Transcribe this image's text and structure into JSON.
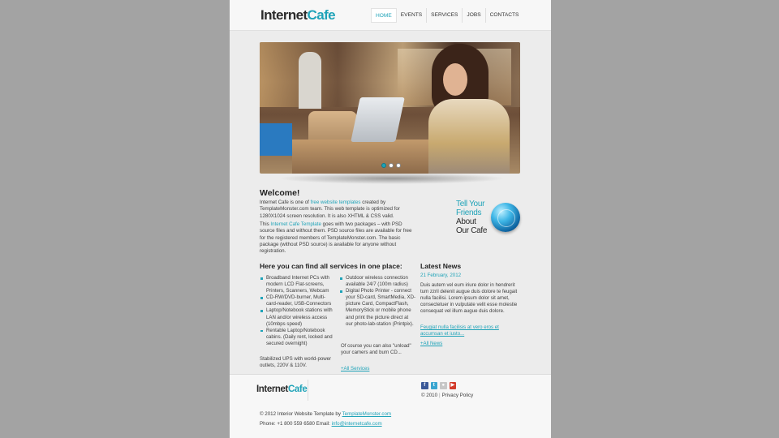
{
  "header": {
    "logo_part1": "Internet",
    "logo_part2": "Cafe",
    "nav": [
      {
        "label": "HOME",
        "active": true
      },
      {
        "label": "EVENTS",
        "active": false
      },
      {
        "label": "SERVICES",
        "active": false
      },
      {
        "label": "JOBS",
        "active": false
      },
      {
        "label": "CONTACTS",
        "active": false
      }
    ]
  },
  "slider": {
    "dots": [
      true,
      false,
      false
    ]
  },
  "welcome": {
    "title": "Welcome!",
    "p1_a": "Internet Cafe is one of ",
    "p1_link": "free website templates",
    "p1_b": " created by TemplateMonster.com team. This web template is optimized for 1280X1024 screen resolution. It is also XHTML & CSS valid.",
    "p2_a": "This ",
    "p2_link": "Internet Cafe Template",
    "p2_b": " goes with two packages – with PSD source files and without them. PSD source files are available for free for the registered members of TemplateMonster.com. The basic package (without PSD source) is available for anyone without registration."
  },
  "tell_friends": {
    "line1": "Tell Your",
    "line2": "Friends",
    "line3": "About",
    "line4": "Our Cafe"
  },
  "services": {
    "title": "Here you can find all services in one place:",
    "col1": [
      "Broadband Internet PCs with modern LCD Flat-screens, Printers, Scanners, Webcam",
      "CD-RW/DVD-burner, Multi-card-reader, USB-Connectors",
      "Laptop/Notebook stations with LAN and/or wireless access (10mbps speed)",
      "Rentable Laptop/Notebook cabins. (Daily rent, locked and secured overnight)"
    ],
    "col1_note": "Stabilized UPS with world-power outlets, 220V & 110V.",
    "col2": [
      "Outdoor wireless connection available 24/7 (100m radius)",
      "Digital Photo Printer - connect your SD-card, SmartMedia, XD-picture Card, CompactFlash, MemoryStick or mobile phone and print the picture direct at our photo-lab-station (Printpix)."
    ],
    "col2_note": "Of course you can also \"unload\" your camers and burn CD...",
    "all_link": "+All Services"
  },
  "news": {
    "title": "Latest News",
    "date": "21 February, 2012",
    "text": "Duis autem vel eum iriure dolor in hendrerit tum zzril delenit augue duis dolore te feugait nulla facilisi. Lorem ipsum dolor sit amet, consectetuer in vulputate velit esse molestie consequat vel illum augue duis dolore.",
    "more_link": "Feugiat nulla facilisis at vero eros et accumsan et iusto...",
    "all_link": "+All News"
  },
  "footer": {
    "logo_part1": "Internet",
    "logo_part2": "Cafe",
    "year": "© 2010",
    "privacy": "Privacy Policy",
    "credit_a": "© 2012 Interior Website Template by ",
    "credit_link": "TemplateMonster.com",
    "phone_a": "Phone: +1 800 559 6580 Email: ",
    "email": "info@internetcafe.com"
  },
  "colors": {
    "accent": "#1fa3b8",
    "background": "#a3a3a3",
    "page": "#ececec"
  }
}
